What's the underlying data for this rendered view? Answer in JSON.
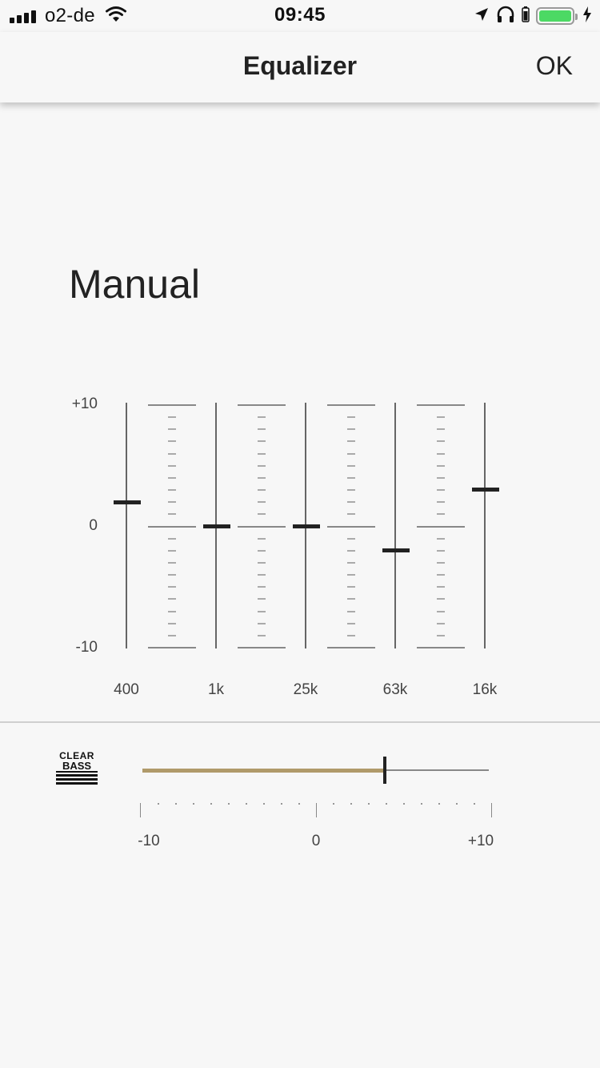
{
  "status_bar": {
    "carrier": "o2-de",
    "time": "09:45",
    "signal_bars": 4,
    "battery_level": 1.0,
    "battery_color": "#4cd964",
    "icons": [
      "wifi-icon",
      "location-arrow-icon",
      "headphones-icon",
      "battery-icon",
      "charging-icon"
    ]
  },
  "nav": {
    "title": "Equalizer",
    "ok_label": "OK"
  },
  "preset": {
    "name": "Manual"
  },
  "eq": {
    "scale": {
      "max_label": "+10",
      "mid_label": "0",
      "min_label": "-10",
      "max": 10,
      "min": -10
    },
    "bands": [
      {
        "freq": "400",
        "value": 2
      },
      {
        "freq": "1k",
        "value": 0
      },
      {
        "freq": "25k",
        "value": 0
      },
      {
        "freq": "63k",
        "value": -2
      },
      {
        "freq": "16k",
        "value": 3
      }
    ]
  },
  "clear_bass": {
    "logo_top": "CLEAR",
    "logo_bottom": "BASS",
    "value": 4,
    "min": -10,
    "max": 10,
    "min_label": "-10",
    "mid_label": "0",
    "max_label": "+10",
    "accent_color": "#b09a6a"
  }
}
